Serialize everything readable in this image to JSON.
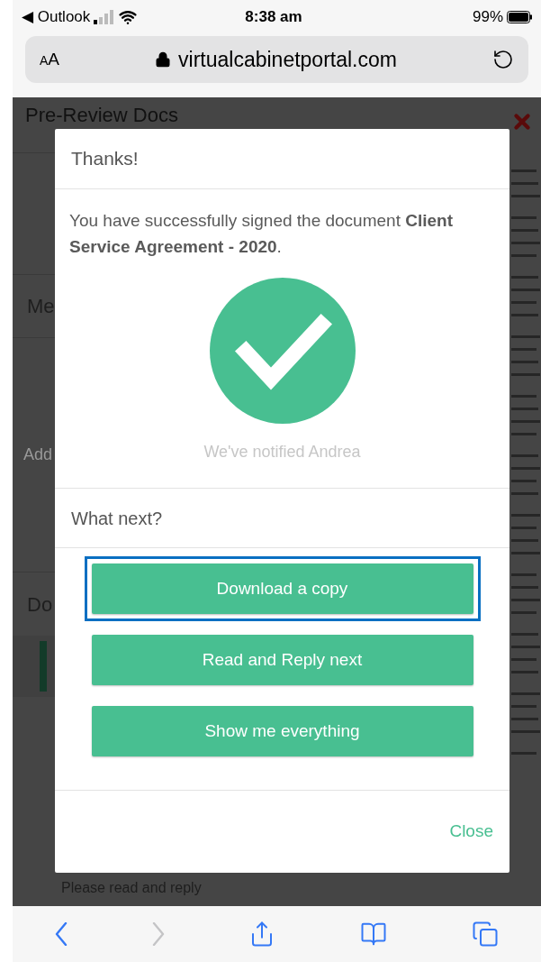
{
  "status_bar": {
    "back_app": "◀ Outlook",
    "time": "8:38 am",
    "battery": "99%"
  },
  "address_bar": {
    "text_size": "AA",
    "url": "virtualcabinetportal.com"
  },
  "background_page": {
    "title": "Pre-Review Docs",
    "section_1": "Me",
    "field_placeholder": "Add",
    "section_2": "Do",
    "task": "Please read and reply"
  },
  "dialog": {
    "title": "Thanks!",
    "message": "You have successfully signed the document **Client Service Agreement - 2020**.",
    "notice": "We've notified Andrea",
    "next_heading": "What next?",
    "actions": [
      {
        "label": "Download a copy",
        "selected": true
      },
      {
        "label": "Read and Reply next",
        "selected": false
      },
      {
        "label": "Show me everything",
        "selected": false
      }
    ],
    "close": "Close"
  },
  "toolbar": [
    {
      "kind": "back",
      "disabled": false
    },
    {
      "kind": "forward",
      "disabled": true
    },
    {
      "kind": "share",
      "disabled": false
    },
    {
      "kind": "bookmarks",
      "disabled": false
    },
    {
      "kind": "tabs",
      "disabled": false
    }
  ]
}
